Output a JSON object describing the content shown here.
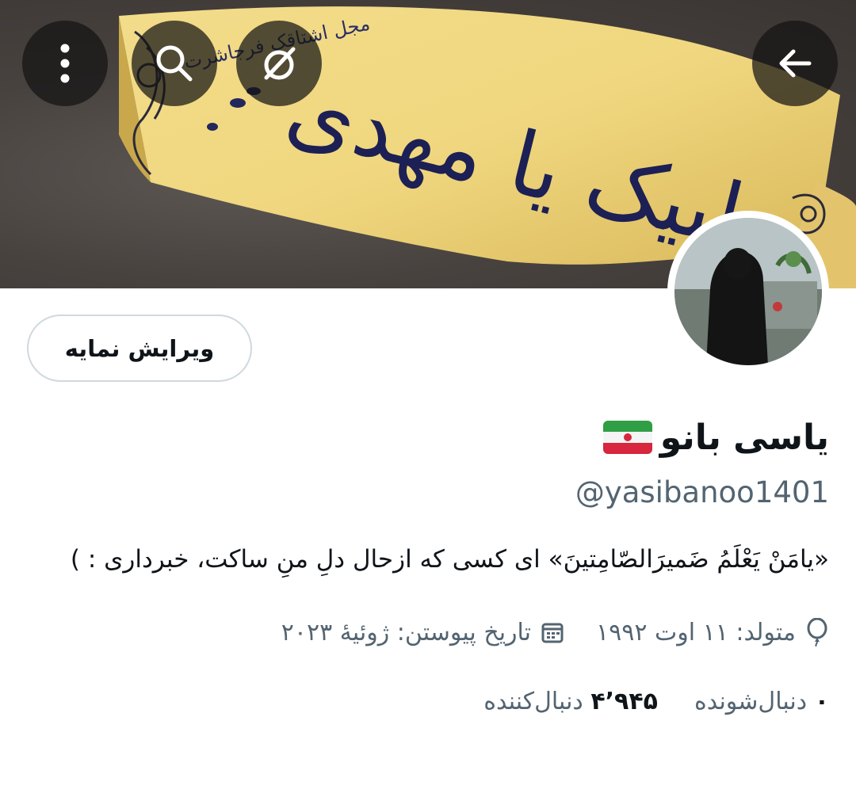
{
  "header": {
    "banner_text": "لبیک یا مهدی",
    "banner_small_text": "مجل اشتاقک فرجاشرت",
    "back_icon": "arrow-left-icon",
    "buttons": [
      "back",
      "hide",
      "search",
      "more"
    ]
  },
  "profile": {
    "edit_button_label": "ویرایش نمایه",
    "display_name": "یاسی بانو",
    "flag": "iran-flag-icon",
    "handle": "@yasibanoo1401",
    "bio": "«یامَنْ یَعْلَمُ ضَمیرَالصّامِتینَ» ای کسی که ازحال دلِ منِ ساکت، خبرداری : )",
    "birth": "متولد: ۱۱ اوت ۱۹۹۲",
    "joined": "تاریخ پیوستن: ژوئیهٔ ۲۰۲۳",
    "following_count": "۰",
    "following_label": "دنبال‌شونده",
    "followers_count": "۴٬۹۴۵",
    "followers_label": "دنبال‌کننده"
  },
  "colors": {
    "text_primary": "#0f1419",
    "text_secondary": "#536471",
    "border": "#cfd9de",
    "ribbon": "#e9cf7a",
    "ribbon_ink": "#1c2054"
  }
}
